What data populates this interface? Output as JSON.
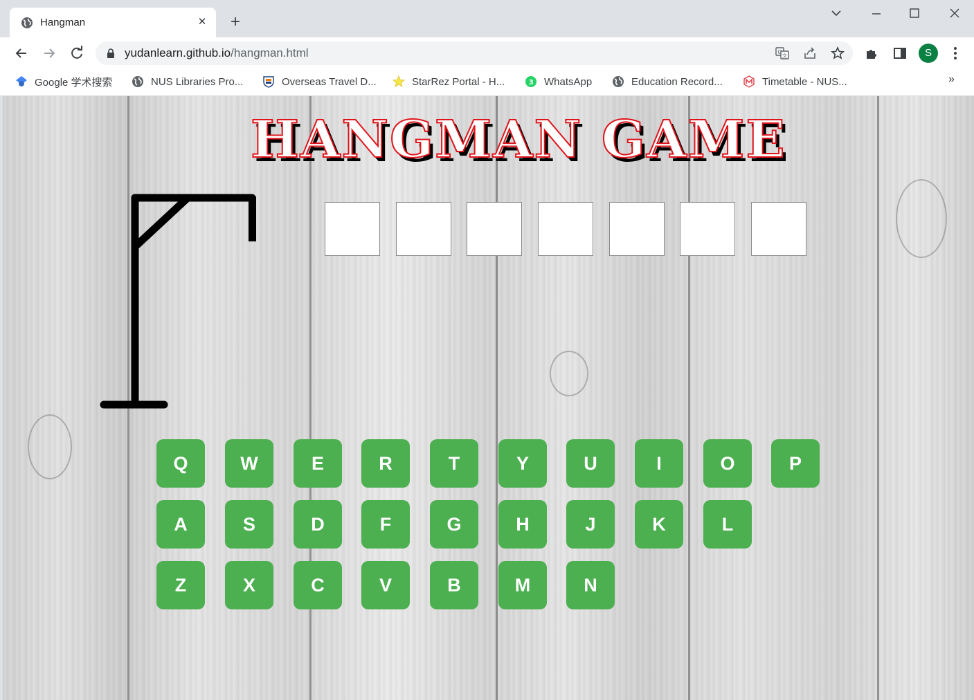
{
  "browser": {
    "tab": {
      "title": "Hangman",
      "favicon": "globe-icon"
    },
    "new_tab_label": "+",
    "window_controls": [
      "chevron-down-icon",
      "minimize-icon",
      "maximize-icon",
      "close-icon"
    ],
    "address": {
      "domain": "yudanlearn.github.io",
      "path": "/hangman.html"
    },
    "profile_initial": "S",
    "accent_color": "#0b8043"
  },
  "bookmarks": [
    {
      "label": "Google 学术搜索",
      "icon": "google-scholar-icon"
    },
    {
      "label": "NUS Libraries Pro...",
      "icon": "globe-icon"
    },
    {
      "label": "Overseas Travel D...",
      "icon": "nus-crest-icon"
    },
    {
      "label": "StarRez Portal - H...",
      "icon": "star-icon"
    },
    {
      "label": "WhatsApp",
      "icon": "whatsapp-icon"
    },
    {
      "label": "Education Record...",
      "icon": "globe-icon"
    },
    {
      "label": "Timetable - NUS...",
      "icon": "nusmods-icon"
    }
  ],
  "bookmarks_more": "»",
  "game": {
    "title": "HANGMAN GAME",
    "title_color": "#e0141b",
    "key_color": "#4caf50",
    "word_slots": [
      "",
      "",
      "",
      "",
      "",
      "",
      ""
    ],
    "keyboard_rows": [
      [
        "Q",
        "W",
        "E",
        "R",
        "T",
        "Y",
        "U",
        "I",
        "O",
        "P"
      ],
      [
        "A",
        "S",
        "D",
        "F",
        "G",
        "H",
        "J",
        "K",
        "L"
      ],
      [
        "Z",
        "X",
        "C",
        "V",
        "B",
        "M",
        "N"
      ]
    ]
  }
}
